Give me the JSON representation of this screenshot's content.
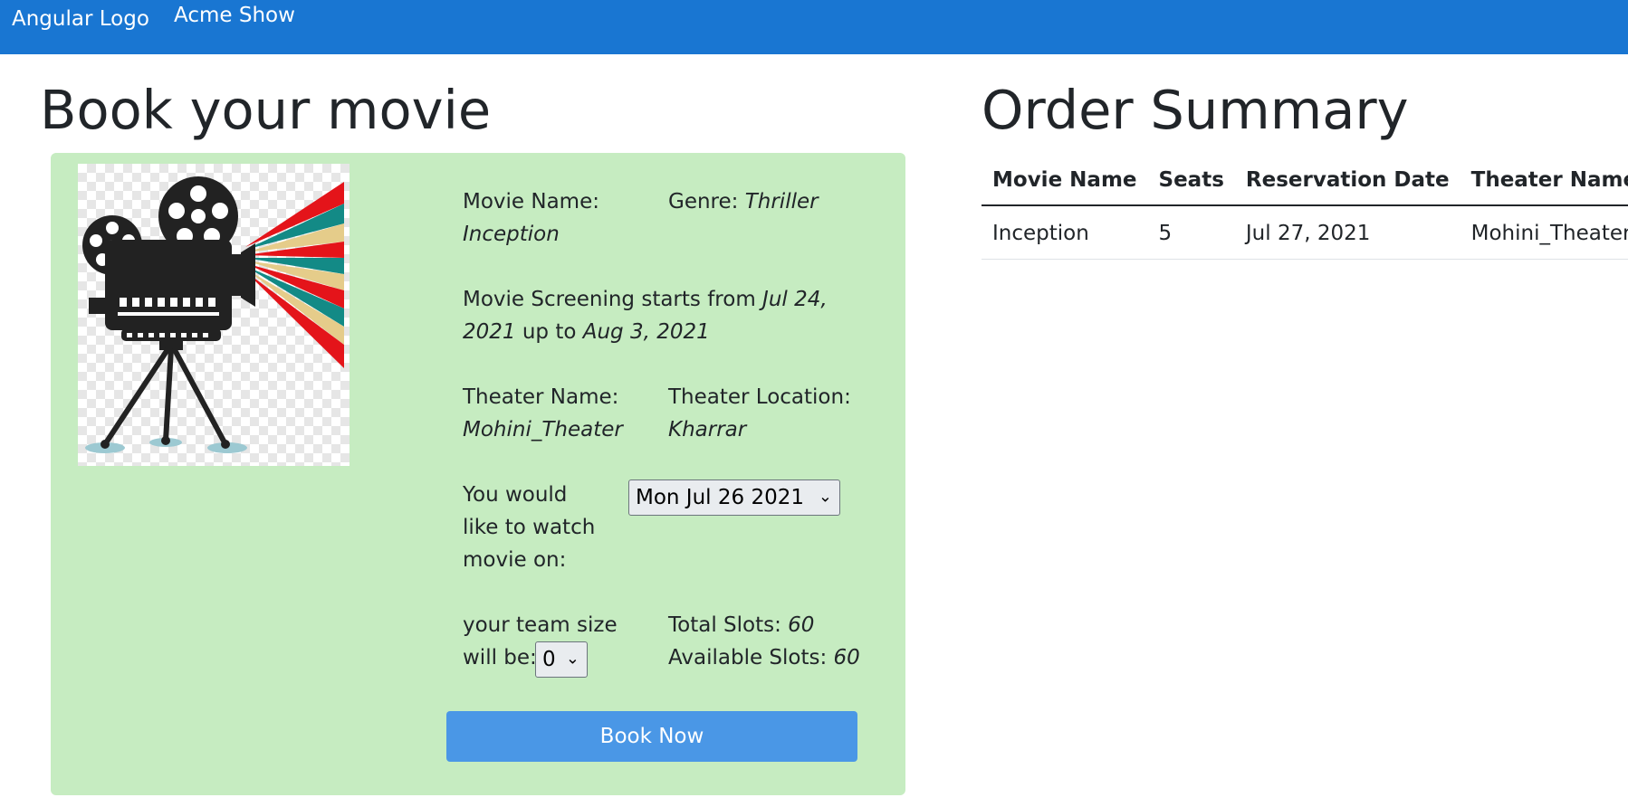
{
  "nav": {
    "logo_alt": "Angular Logo",
    "brand": "Acme Show"
  },
  "booking": {
    "title": "Book your movie",
    "movie_name_label": "Movie Name:",
    "movie_name": "Inception",
    "genre_label": "Genre:",
    "genre": "Thriller",
    "screening_prefix": "Movie Screening starts from",
    "screening_start": "Jul 24, 2021",
    "screening_mid": "up to",
    "screening_end": "Aug 3, 2021",
    "theater_name_label": "Theater Name:",
    "theater_name": "Mohini_Theater",
    "theater_location_label": "Theater Location:",
    "theater_location": "Kharrar",
    "watch_label": "You would like to watch movie on:",
    "selected_date": "Mon Jul 26 2021",
    "team_label": "your team size will be:",
    "team_size": "0",
    "total_slots_label": "Total Slots:",
    "total_slots": "60",
    "available_slots_label": "Available Slots:",
    "available_slots": "60",
    "book_button": "Book Now",
    "poster_icon": "movie-projector-icon"
  },
  "summary": {
    "title": "Order Summary",
    "headers": [
      "Movie Name",
      "Seats",
      "Reservation Date",
      "Theater Name"
    ],
    "rows": [
      [
        "Inception",
        "5",
        "Jul 27, 2021",
        "Mohini_Theater"
      ]
    ]
  },
  "colors": {
    "navbar": "#1976d2",
    "card": "#c6ecc1",
    "button": "#4a97e6"
  }
}
